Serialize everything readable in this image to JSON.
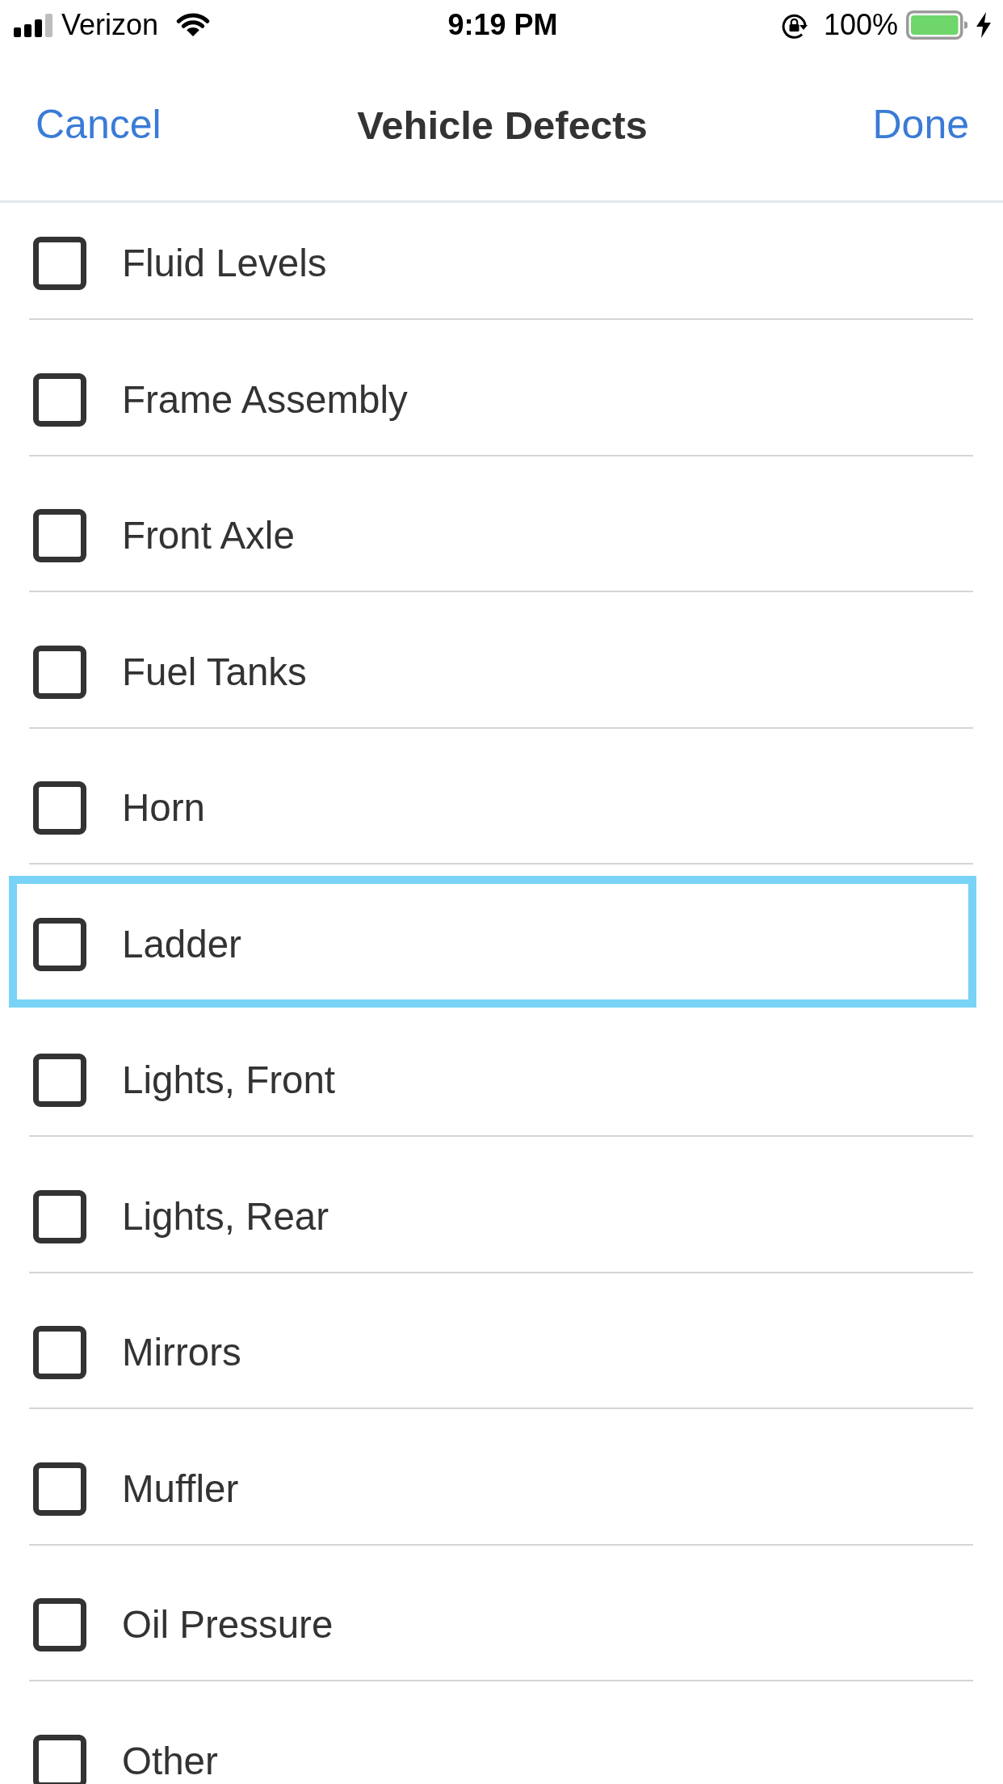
{
  "status_bar": {
    "carrier": "Verizon",
    "time": "9:19 PM",
    "battery": "100%"
  },
  "nav_bar": {
    "left_button": "Cancel",
    "title": "Vehicle Defects",
    "right_button": "Done"
  },
  "items": [
    {
      "label": "Fluid Levels",
      "checked": false,
      "selected": false
    },
    {
      "label": "Frame Assembly",
      "checked": false,
      "selected": false
    },
    {
      "label": "Front Axle",
      "checked": false,
      "selected": false
    },
    {
      "label": "Fuel Tanks",
      "checked": false,
      "selected": false
    },
    {
      "label": "Horn",
      "checked": false,
      "selected": false
    },
    {
      "label": "Ladder",
      "checked": false,
      "selected": true
    },
    {
      "label": "Lights, Front",
      "checked": false,
      "selected": false
    },
    {
      "label": "Lights, Rear",
      "checked": false,
      "selected": false
    },
    {
      "label": "Mirrors",
      "checked": false,
      "selected": false
    },
    {
      "label": "Muffler",
      "checked": false,
      "selected": false
    },
    {
      "label": "Oil Pressure",
      "checked": false,
      "selected": false
    },
    {
      "label": "Other",
      "checked": false,
      "selected": false
    }
  ]
}
